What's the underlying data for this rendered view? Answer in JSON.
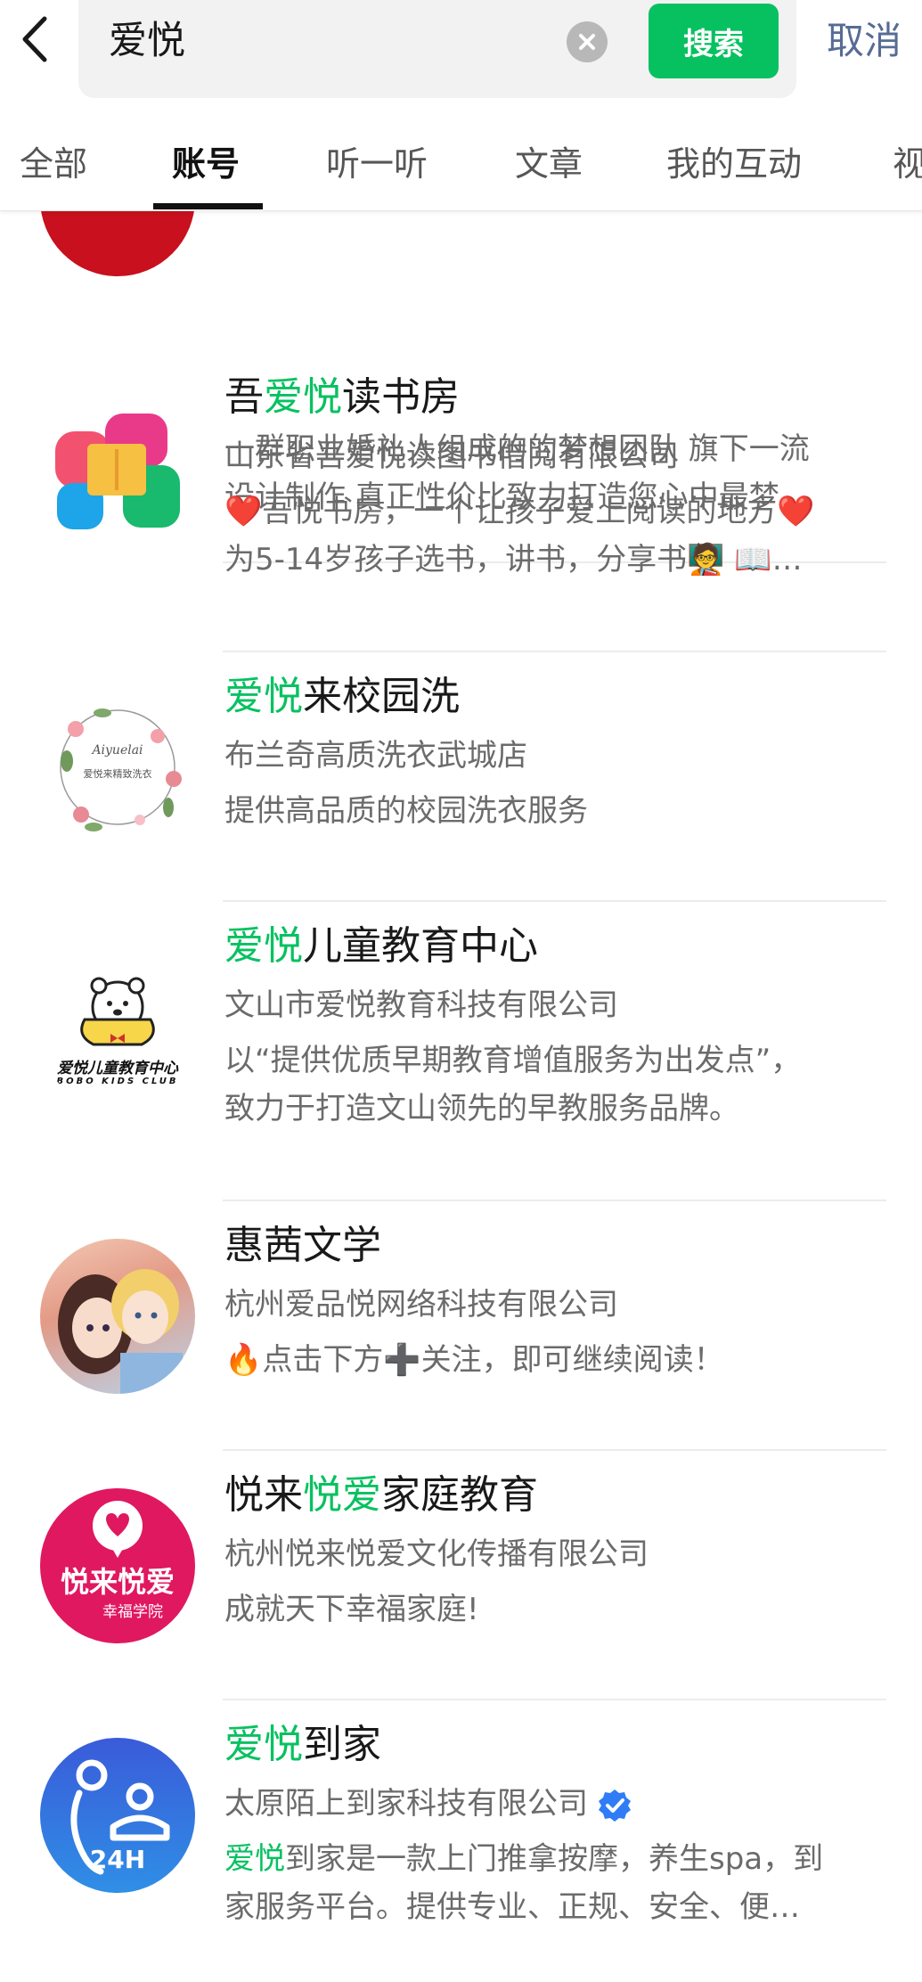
{
  "header": {
    "search_query": "爱悦",
    "search_button": "搜索",
    "cancel": "取消"
  },
  "tabs": [
    {
      "label": "全部",
      "active": false
    },
    {
      "label": "账号",
      "active": true
    },
    {
      "label": "听一听",
      "active": false
    },
    {
      "label": "文章",
      "active": false
    },
    {
      "label": "我的互动",
      "active": false
    },
    {
      "label": "视",
      "active": false
    }
  ],
  "results": [
    {
      "title_parts": [],
      "subtitle": "",
      "desc_lines": [
        "一群职业婚礼人组成的的梦想团队 旗下一流",
        "设计制作 真正性价比致力打造您心中最梦…"
      ]
    },
    {
      "title_parts": [
        "吾",
        "爱悦",
        "读书房"
      ],
      "subtitle": "山东省吾爱悦读图书借阅有限公司",
      "desc_lines": [
        "❤️吾悦书房，一个让孩子爱上阅读的地方❤️",
        "为5-14岁孩子选书，讲书，分享书🧑‍🏫 📖…"
      ]
    },
    {
      "title_parts": [
        "",
        "爱悦",
        "来校园洗"
      ],
      "subtitle": "布兰奇高质洗衣武城店",
      "desc_lines": [
        "提供高品质的校园洗衣服务"
      ],
      "avatar_text": [
        "Aiyuelai",
        "爱悦来精致洗衣"
      ]
    },
    {
      "title_parts": [
        "",
        "爱悦",
        "儿童教育中心"
      ],
      "subtitle": "文山市爱悦教育科技有限公司",
      "desc_lines": [
        "以“提供优质早期教育增值服务为出发点”，",
        "致力于打造文山领先的早教服务品牌。"
      ],
      "avatar_text": [
        "爱悦儿童教育中心",
        "BOBO KIDS CLUB"
      ]
    },
    {
      "title_parts": [
        "惠茜文学",
        "",
        ""
      ],
      "subtitle": "杭州爱品悦网络科技有限公司",
      "desc_lines": [
        "🔥点击下方➕关注，即可继续阅读！"
      ]
    },
    {
      "title_parts": [
        "悦来",
        "悦爱",
        "家庭教育"
      ],
      "subtitle": "杭州悦来悦爱文化传播有限公司",
      "desc_lines": [
        "成就天下幸福家庭!"
      ],
      "avatar_text": [
        "悦来悦爱",
        "幸福学院"
      ]
    },
    {
      "title_parts": [
        "",
        "爱悦",
        "到家"
      ],
      "subtitle": "太原陌上到家科技有限公司",
      "desc_hl": "爱悦",
      "desc_lines": [
        "到家是一款上门推拿按摩，养生spa，到",
        "家服务平台。提供专业、正规、安全、便…"
      ],
      "avatar_text": [
        "24H"
      ]
    }
  ],
  "colors": {
    "accent": "#07c160",
    "link": "#576b95",
    "text": "#191919",
    "secondary": "#6b6b6b"
  },
  "icons": [
    "back-arrow-icon",
    "clear-icon",
    "verified-icon"
  ]
}
